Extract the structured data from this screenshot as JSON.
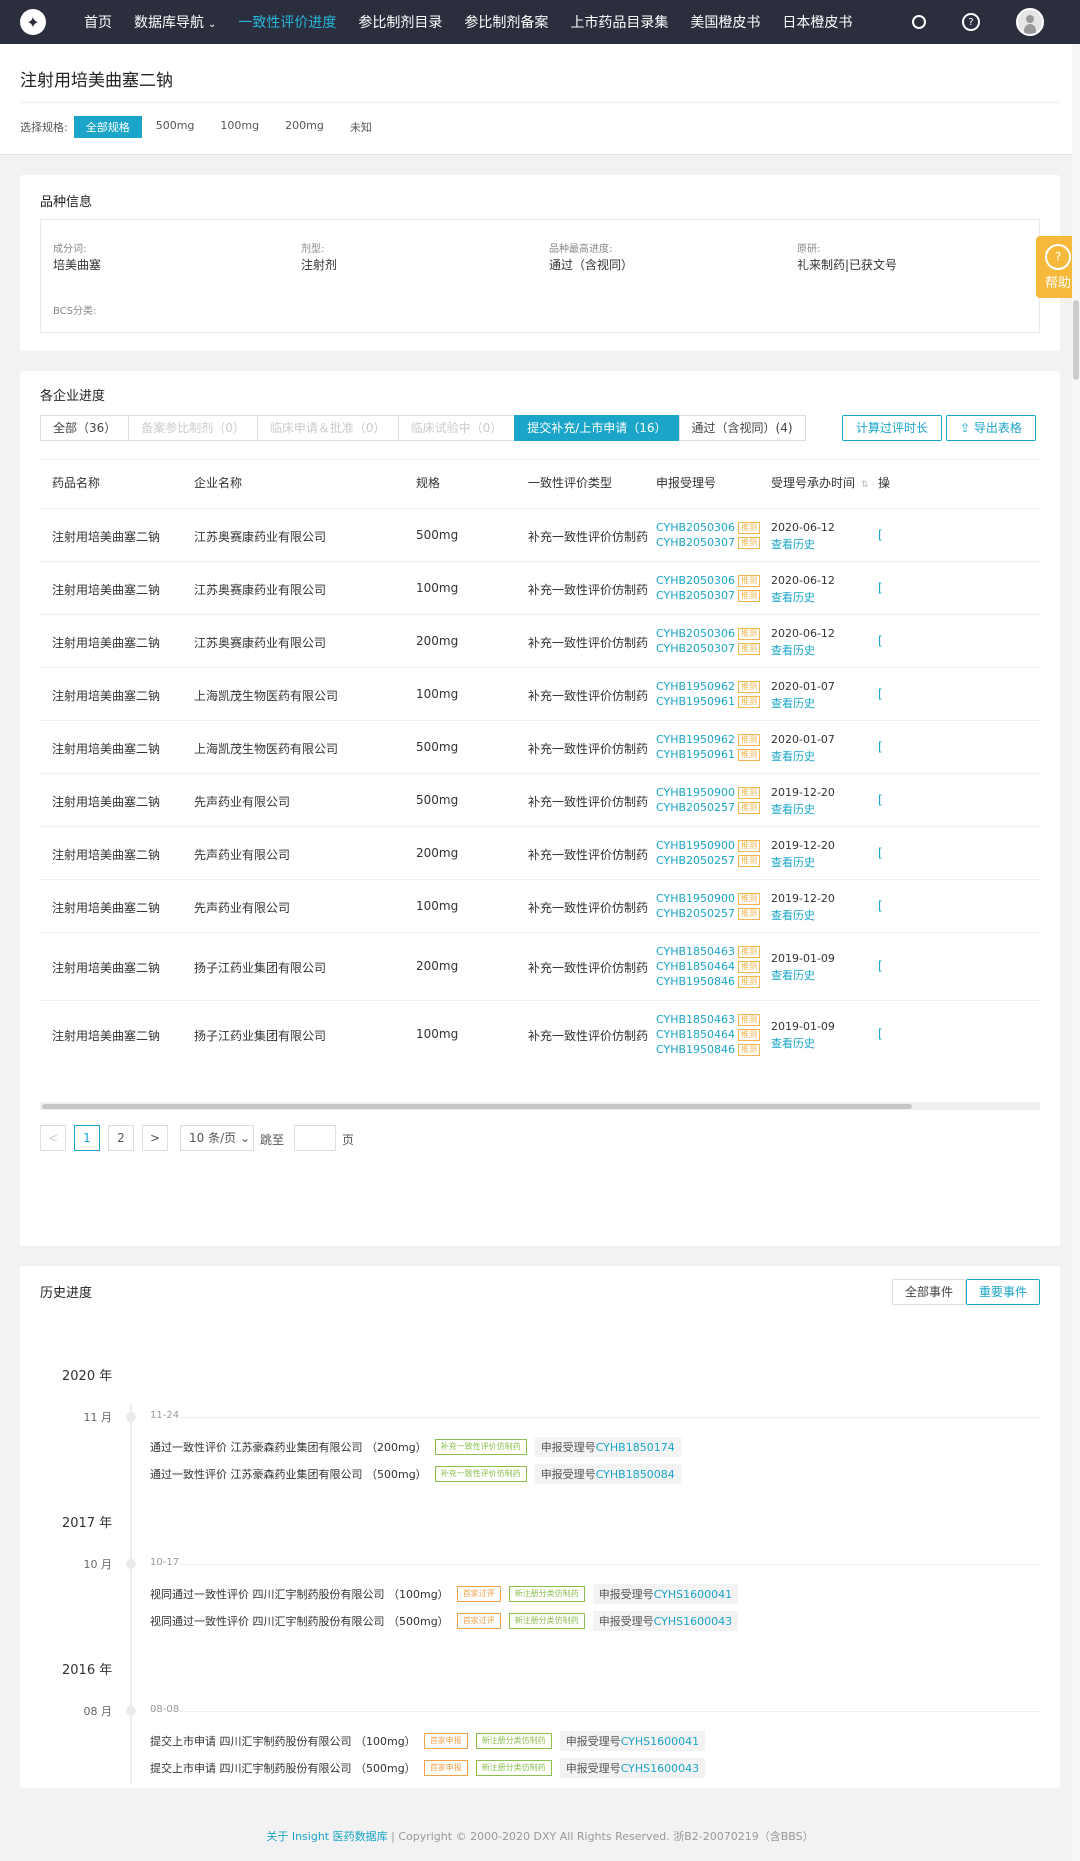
{
  "nav": {
    "logo": "✦",
    "items": [
      "首页",
      "数据库导航",
      "一致性评价进度",
      "参比制剂目录",
      "参比制剂备案",
      "上市药品目录集",
      "美国橙皮书",
      "日本橙皮书"
    ],
    "active_index": 2,
    "dropdown_glyph": "⌄"
  },
  "header": {
    "title": "注射用培美曲塞二钠",
    "spec_label": "选择规格:",
    "specs": [
      "全部规格",
      "500mg",
      "100mg",
      "200mg",
      "未知"
    ]
  },
  "variety": {
    "title": "品种信息",
    "fields": [
      {
        "label": "成分词:",
        "value": "培美曲塞"
      },
      {
        "label": "剂型:",
        "value": "注射剂"
      },
      {
        "label": "品种最高进度:",
        "value": "通过（含视同）"
      },
      {
        "label": "原研:",
        "value": "礼来制药|已获文号"
      },
      {
        "label": "BCS分类:",
        "value": ""
      }
    ]
  },
  "progress": {
    "title": "各企业进度",
    "tabs": [
      "全部（36）",
      "备案参比制剂（0）",
      "临床申请＆批准（0）",
      "临床试验中（0）",
      "提交补充/上市申请（16）",
      "通过（含视同）(4)"
    ],
    "tab_states": [
      "normal",
      "disabled",
      "disabled",
      "disabled",
      "active",
      "normal"
    ],
    "calc_btn": "计算过评时长",
    "export_btn": "导出表格",
    "columns": [
      "药品名称",
      "企业名称",
      "规格",
      "一致性评价类型",
      "申报受理号",
      "受理号承办时间",
      "操"
    ],
    "tag_label": "推测",
    "rows": [
      {
        "name": "注射用培美曲塞二钠",
        "company": "江苏奥赛康药业有限公司",
        "spec": "500mg",
        "type": "补充一致性评价仿制药",
        "codes": [
          "CYHB2050306",
          "CYHB2050307"
        ],
        "date": "2020-06-12",
        "history": "查看历史"
      },
      {
        "name": "注射用培美曲塞二钠",
        "company": "江苏奥赛康药业有限公司",
        "spec": "100mg",
        "type": "补充一致性评价仿制药",
        "codes": [
          "CYHB2050306",
          "CYHB2050307"
        ],
        "date": "2020-06-12",
        "history": "查看历史"
      },
      {
        "name": "注射用培美曲塞二钠",
        "company": "江苏奥赛康药业有限公司",
        "spec": "200mg",
        "type": "补充一致性评价仿制药",
        "codes": [
          "CYHB2050306",
          "CYHB2050307"
        ],
        "date": "2020-06-12",
        "history": "查看历史"
      },
      {
        "name": "注射用培美曲塞二钠",
        "company": "上海凯茂生物医药有限公司",
        "spec": "100mg",
        "type": "补充一致性评价仿制药",
        "codes": [
          "CYHB1950962",
          "CYHB1950961"
        ],
        "date": "2020-01-07",
        "history": "查看历史"
      },
      {
        "name": "注射用培美曲塞二钠",
        "company": "上海凯茂生物医药有限公司",
        "spec": "500mg",
        "type": "补充一致性评价仿制药",
        "codes": [
          "CYHB1950962",
          "CYHB1950961"
        ],
        "date": "2020-01-07",
        "history": "查看历史"
      },
      {
        "name": "注射用培美曲塞二钠",
        "company": "先声药业有限公司",
        "spec": "500mg",
        "type": "补充一致性评价仿制药",
        "codes": [
          "CYHB1950900",
          "CYHB2050257"
        ],
        "date": "2019-12-20",
        "history": "查看历史"
      },
      {
        "name": "注射用培美曲塞二钠",
        "company": "先声药业有限公司",
        "spec": "200mg",
        "type": "补充一致性评价仿制药",
        "codes": [
          "CYHB1950900",
          "CYHB2050257"
        ],
        "date": "2019-12-20",
        "history": "查看历史"
      },
      {
        "name": "注射用培美曲塞二钠",
        "company": "先声药业有限公司",
        "spec": "100mg",
        "type": "补充一致性评价仿制药",
        "codes": [
          "CYHB1950900",
          "CYHB2050257"
        ],
        "date": "2019-12-20",
        "history": "查看历史"
      },
      {
        "name": "注射用培美曲塞二钠",
        "company": "扬子江药业集团有限公司",
        "spec": "200mg",
        "type": "补充一致性评价仿制药",
        "codes": [
          "CYHB1850463",
          "CYHB1850464",
          "CYHB1950846"
        ],
        "date": "2019-01-09",
        "history": "查看历史"
      },
      {
        "name": "注射用培美曲塞二钠",
        "company": "扬子江药业集团有限公司",
        "spec": "100mg",
        "type": "补充一致性评价仿制药",
        "codes": [
          "CYHB1850463",
          "CYHB1850464",
          "CYHB1950846"
        ],
        "date": "2019-01-09",
        "history": "查看历史"
      }
    ],
    "pager": {
      "prev": "<",
      "pages": [
        "1",
        "2"
      ],
      "next": ">",
      "size": "10 条/页",
      "jump_label": "跳至",
      "page_unit": "页"
    }
  },
  "history": {
    "title": "历史进度",
    "btn_all": "全部事件",
    "btn_important": "重要事件",
    "code_prefix": "申报受理号",
    "groups": [
      {
        "year": "2020 年",
        "month": "11 月",
        "date": "11-24",
        "events": [
          {
            "text": "通过一致性评价 江苏豪森药业集团有限公司 （200mg）",
            "tags": [
              {
                "label": "补充一致性评价仿制药",
                "color": "g"
              }
            ],
            "code": "CYHB1850174"
          },
          {
            "text": "通过一致性评价 江苏豪森药业集团有限公司 （500mg）",
            "tags": [
              {
                "label": "补充一致性评价仿制药",
                "color": "g"
              }
            ],
            "code": "CYHB1850084"
          }
        ]
      },
      {
        "year": "2017 年",
        "month": "10 月",
        "date": "10-17",
        "events": [
          {
            "text": "视同通过一致性评价 四川汇宇制药股份有限公司 （100mg）",
            "tags": [
              {
                "label": "首家过评",
                "color": "o"
              },
              {
                "label": "新注册分类仿制药",
                "color": "g"
              }
            ],
            "code": "CYHS1600041"
          },
          {
            "text": "视同通过一致性评价 四川汇宇制药股份有限公司 （500mg）",
            "tags": [
              {
                "label": "首家过评",
                "color": "o"
              },
              {
                "label": "新注册分类仿制药",
                "color": "g"
              }
            ],
            "code": "CYHS1600043"
          }
        ]
      },
      {
        "year": "2016 年",
        "month": "08 月",
        "date": "08-08",
        "events": [
          {
            "text": "提交上市申请 四川汇宇制药股份有限公司 （100mg）",
            "tags": [
              {
                "label": "首家申报",
                "color": "o"
              },
              {
                "label": "新注册分类仿制药",
                "color": "g"
              }
            ],
            "code": "CYHS1600041"
          },
          {
            "text": "提交上市申请 四川汇宇制药股份有限公司 （500mg）",
            "tags": [
              {
                "label": "首家申报",
                "color": "o"
              },
              {
                "label": "新注册分类仿制药",
                "color": "g"
              }
            ],
            "code": "CYHS1600043"
          }
        ]
      }
    ]
  },
  "help": {
    "label": "帮助",
    "icon": "?"
  },
  "footer": {
    "link": "关于 Insight 医药数据库",
    "sep": "|",
    "text": "Copyright © 2000-2020 DXY All Rights Reserved. 浙B2-20070219（含BBS）"
  }
}
